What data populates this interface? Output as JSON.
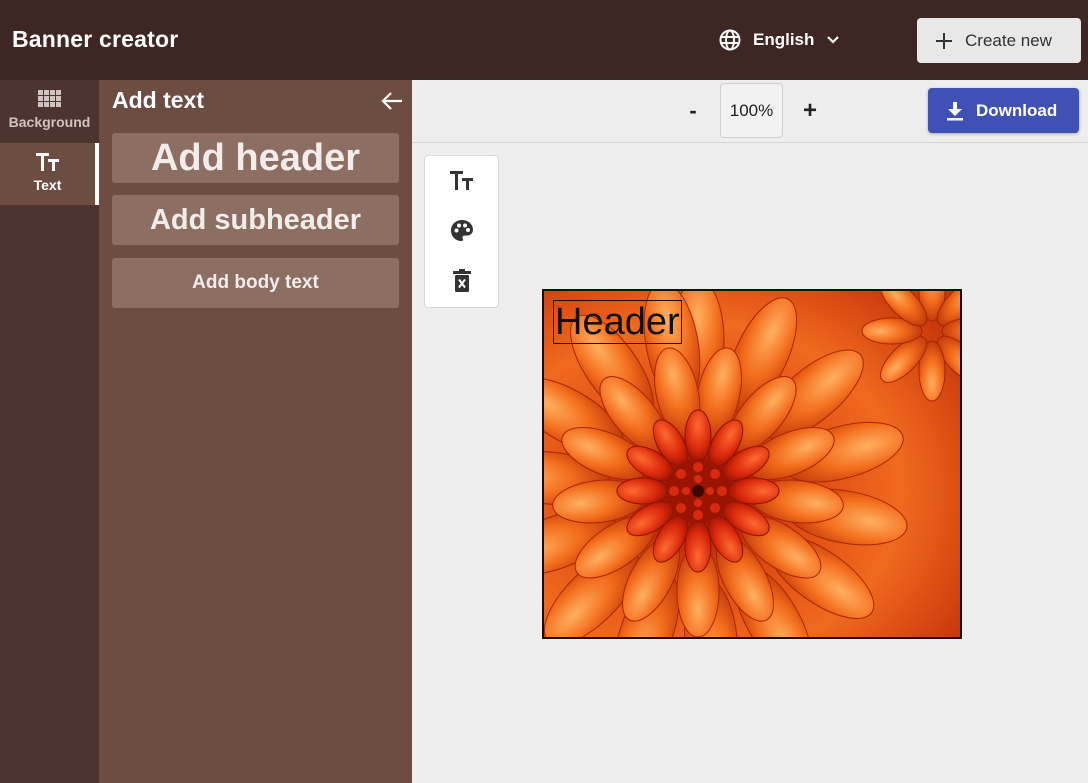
{
  "app": {
    "title": "Banner creator"
  },
  "header": {
    "language": "English",
    "create_new_label": "Create new"
  },
  "rail": {
    "items": [
      {
        "label": "Background",
        "icon": "grid-icon",
        "active": false
      },
      {
        "label": "Text",
        "icon": "text-size-icon",
        "active": true
      }
    ]
  },
  "panel": {
    "title": "Add text",
    "buttons": {
      "header": "Add header",
      "subheader": "Add subheader",
      "body": "Add body text"
    }
  },
  "canvas_toolbar": {
    "zoom_minus": "-",
    "zoom_value": "100%",
    "zoom_plus": "+",
    "download_label": "Download"
  },
  "float_tools": [
    "text-size-icon",
    "palette-icon",
    "delete-icon"
  ],
  "banner": {
    "header_text": "Header",
    "background": "orange chrysanthemum photo"
  },
  "colors": {
    "topbar": "#3e2723",
    "rail": "#4e342e",
    "panel": "#6d4c41",
    "panel_button": "#8d6e63",
    "download": "#3f51b5",
    "canvas_bg": "#eeeeee"
  }
}
